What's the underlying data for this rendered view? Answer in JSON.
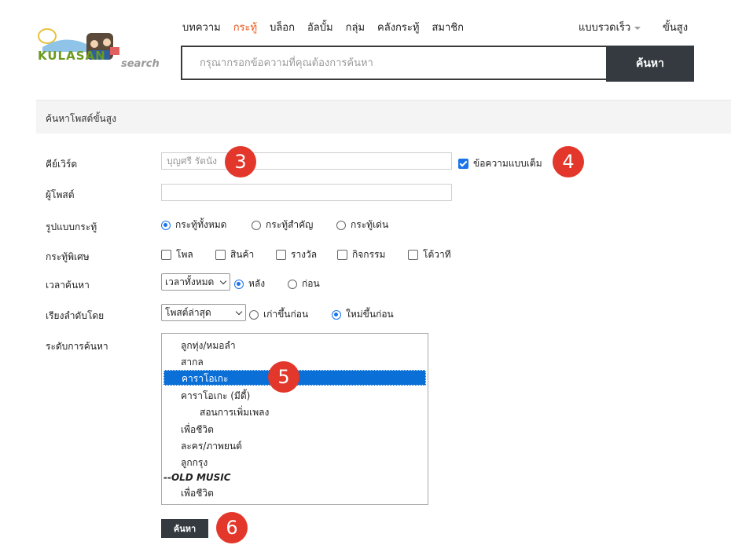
{
  "header": {
    "logo_text": "KULASAN",
    "logo_search": "search",
    "nav": [
      "บทความ",
      "กระทู้",
      "บล็อก",
      "อัลบั้ม",
      "กลุ่ม",
      "คลังกระทู้",
      "สมาชิก"
    ],
    "nav_active": 1,
    "quick_search": "แบบรวดเร็ว",
    "advanced": "ขั้นสูง",
    "search_placeholder": "กรุณากรอกข้อความที่คุณต้องการค้นหา",
    "search_button": "ค้นหา"
  },
  "section_title": "ค้นหาโพสต์ขั้นสูง",
  "form": {
    "keyword_label": "คีย์เวิร์ด",
    "keyword_value": "บุญศรี รัตนัง",
    "fulltext_label": "ข้อความแบบเต็ม",
    "fulltext_checked": true,
    "poster_label": "ผู้โพสต์",
    "poster_value": "",
    "thread_type_label": "รูปแบบกระทู้",
    "thread_types": [
      "กระทู้ทั้งหมด",
      "กระทู้สำคัญ",
      "กระทู้เด่น"
    ],
    "thread_type_selected": 0,
    "special_label": "กระทู้พิเศษ",
    "special_options": [
      "โพล",
      "สินค้า",
      "รางวัล",
      "กิจกรรม",
      "โต้วาที"
    ],
    "time_label": "เวลาค้นหา",
    "time_select": "เวลาทั้งหมด",
    "time_options": [
      "หลัง",
      "ก่อน"
    ],
    "time_selected": 0,
    "sort_label": "เรียงลำดับโดย",
    "sort_select": "โพสต์ล่าสุด",
    "sort_options": [
      "เก่าขึ้นก่อน",
      "ใหม่ขึ้นก่อน"
    ],
    "sort_selected": 1,
    "range_label": "ระดับการค้นหา",
    "forum_list": [
      {
        "label": "ลูกทุ่ง/หมอลำ",
        "indent": 1
      },
      {
        "label": "สากล",
        "indent": 1
      },
      {
        "label": "คาราโอเกะ",
        "indent": 1,
        "selected": true
      },
      {
        "label": "คาราโอเกะ (มีดี้)",
        "indent": 1
      },
      {
        "label": "สอนการเพิ่มเพลง",
        "indent": 2
      },
      {
        "label": "เพื่อชีวิต",
        "indent": 1
      },
      {
        "label": "ละคร/ภาพยนต์",
        "indent": 1
      },
      {
        "label": "ลูกกรุง",
        "indent": 1
      },
      {
        "label": "--OLD MUSIC",
        "indent": 0,
        "group": true
      },
      {
        "label": "เพื่อชีวิต",
        "indent": 1
      }
    ],
    "submit_button": "ค้นหา"
  },
  "markers": [
    "3",
    "4",
    "5",
    "6"
  ],
  "colors": {
    "accent": "#1a73e8",
    "nav_active": "#e8591a",
    "dark_button": "#343a40",
    "marker": "#e2372a"
  }
}
